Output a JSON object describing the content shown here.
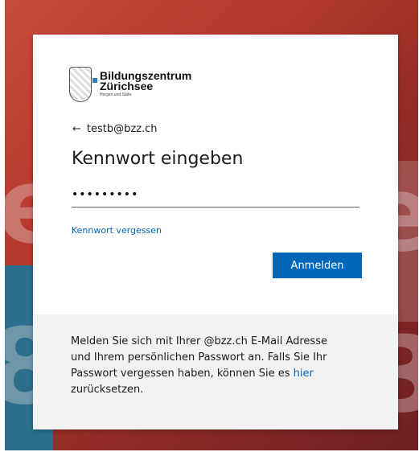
{
  "logo": {
    "name_line1": "Bildungszentrum",
    "name_line2": "Zürichsee",
    "subtitle": "Horgen und Stäfa"
  },
  "account": {
    "back_icon": "arrow-left-icon",
    "email": "testb@bzz.ch"
  },
  "heading": "Kennwort eingeben",
  "password": {
    "value": "•••••••••",
    "type": "password"
  },
  "forgot_link": "Kennwort vergessen",
  "signin_button": "Anmelden",
  "colors": {
    "accent": "#0067b8",
    "footer_bg": "#f2f2f2",
    "background": "#b2382c"
  },
  "footer": {
    "text_before_link": "Melden Sie sich mit Ihrer @bzz.ch E-Mail Adresse und Ihrem persönlichen Passwort an. Falls Sie Ihr Passwort vergessen haben, können Sie es ",
    "link_text": "hier",
    "text_after_link": " zurücksetzen."
  }
}
